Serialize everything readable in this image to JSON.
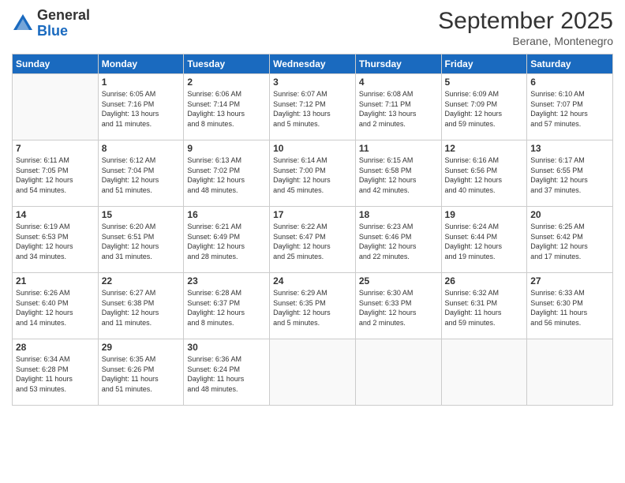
{
  "logo": {
    "general": "General",
    "blue": "Blue"
  },
  "title": {
    "month": "September 2025",
    "location": "Berane, Montenegro"
  },
  "weekdays": [
    "Sunday",
    "Monday",
    "Tuesday",
    "Wednesday",
    "Thursday",
    "Friday",
    "Saturday"
  ],
  "weeks": [
    [
      {
        "day": "",
        "info": ""
      },
      {
        "day": "1",
        "info": "Sunrise: 6:05 AM\nSunset: 7:16 PM\nDaylight: 13 hours\nand 11 minutes."
      },
      {
        "day": "2",
        "info": "Sunrise: 6:06 AM\nSunset: 7:14 PM\nDaylight: 13 hours\nand 8 minutes."
      },
      {
        "day": "3",
        "info": "Sunrise: 6:07 AM\nSunset: 7:12 PM\nDaylight: 13 hours\nand 5 minutes."
      },
      {
        "day": "4",
        "info": "Sunrise: 6:08 AM\nSunset: 7:11 PM\nDaylight: 13 hours\nand 2 minutes."
      },
      {
        "day": "5",
        "info": "Sunrise: 6:09 AM\nSunset: 7:09 PM\nDaylight: 12 hours\nand 59 minutes."
      },
      {
        "day": "6",
        "info": "Sunrise: 6:10 AM\nSunset: 7:07 PM\nDaylight: 12 hours\nand 57 minutes."
      }
    ],
    [
      {
        "day": "7",
        "info": "Sunrise: 6:11 AM\nSunset: 7:05 PM\nDaylight: 12 hours\nand 54 minutes."
      },
      {
        "day": "8",
        "info": "Sunrise: 6:12 AM\nSunset: 7:04 PM\nDaylight: 12 hours\nand 51 minutes."
      },
      {
        "day": "9",
        "info": "Sunrise: 6:13 AM\nSunset: 7:02 PM\nDaylight: 12 hours\nand 48 minutes."
      },
      {
        "day": "10",
        "info": "Sunrise: 6:14 AM\nSunset: 7:00 PM\nDaylight: 12 hours\nand 45 minutes."
      },
      {
        "day": "11",
        "info": "Sunrise: 6:15 AM\nSunset: 6:58 PM\nDaylight: 12 hours\nand 42 minutes."
      },
      {
        "day": "12",
        "info": "Sunrise: 6:16 AM\nSunset: 6:56 PM\nDaylight: 12 hours\nand 40 minutes."
      },
      {
        "day": "13",
        "info": "Sunrise: 6:17 AM\nSunset: 6:55 PM\nDaylight: 12 hours\nand 37 minutes."
      }
    ],
    [
      {
        "day": "14",
        "info": "Sunrise: 6:19 AM\nSunset: 6:53 PM\nDaylight: 12 hours\nand 34 minutes."
      },
      {
        "day": "15",
        "info": "Sunrise: 6:20 AM\nSunset: 6:51 PM\nDaylight: 12 hours\nand 31 minutes."
      },
      {
        "day": "16",
        "info": "Sunrise: 6:21 AM\nSunset: 6:49 PM\nDaylight: 12 hours\nand 28 minutes."
      },
      {
        "day": "17",
        "info": "Sunrise: 6:22 AM\nSunset: 6:47 PM\nDaylight: 12 hours\nand 25 minutes."
      },
      {
        "day": "18",
        "info": "Sunrise: 6:23 AM\nSunset: 6:46 PM\nDaylight: 12 hours\nand 22 minutes."
      },
      {
        "day": "19",
        "info": "Sunrise: 6:24 AM\nSunset: 6:44 PM\nDaylight: 12 hours\nand 19 minutes."
      },
      {
        "day": "20",
        "info": "Sunrise: 6:25 AM\nSunset: 6:42 PM\nDaylight: 12 hours\nand 17 minutes."
      }
    ],
    [
      {
        "day": "21",
        "info": "Sunrise: 6:26 AM\nSunset: 6:40 PM\nDaylight: 12 hours\nand 14 minutes."
      },
      {
        "day": "22",
        "info": "Sunrise: 6:27 AM\nSunset: 6:38 PM\nDaylight: 12 hours\nand 11 minutes."
      },
      {
        "day": "23",
        "info": "Sunrise: 6:28 AM\nSunset: 6:37 PM\nDaylight: 12 hours\nand 8 minutes."
      },
      {
        "day": "24",
        "info": "Sunrise: 6:29 AM\nSunset: 6:35 PM\nDaylight: 12 hours\nand 5 minutes."
      },
      {
        "day": "25",
        "info": "Sunrise: 6:30 AM\nSunset: 6:33 PM\nDaylight: 12 hours\nand 2 minutes."
      },
      {
        "day": "26",
        "info": "Sunrise: 6:32 AM\nSunset: 6:31 PM\nDaylight: 11 hours\nand 59 minutes."
      },
      {
        "day": "27",
        "info": "Sunrise: 6:33 AM\nSunset: 6:30 PM\nDaylight: 11 hours\nand 56 minutes."
      }
    ],
    [
      {
        "day": "28",
        "info": "Sunrise: 6:34 AM\nSunset: 6:28 PM\nDaylight: 11 hours\nand 53 minutes."
      },
      {
        "day": "29",
        "info": "Sunrise: 6:35 AM\nSunset: 6:26 PM\nDaylight: 11 hours\nand 51 minutes."
      },
      {
        "day": "30",
        "info": "Sunrise: 6:36 AM\nSunset: 6:24 PM\nDaylight: 11 hours\nand 48 minutes."
      },
      {
        "day": "",
        "info": ""
      },
      {
        "day": "",
        "info": ""
      },
      {
        "day": "",
        "info": ""
      },
      {
        "day": "",
        "info": ""
      }
    ]
  ]
}
